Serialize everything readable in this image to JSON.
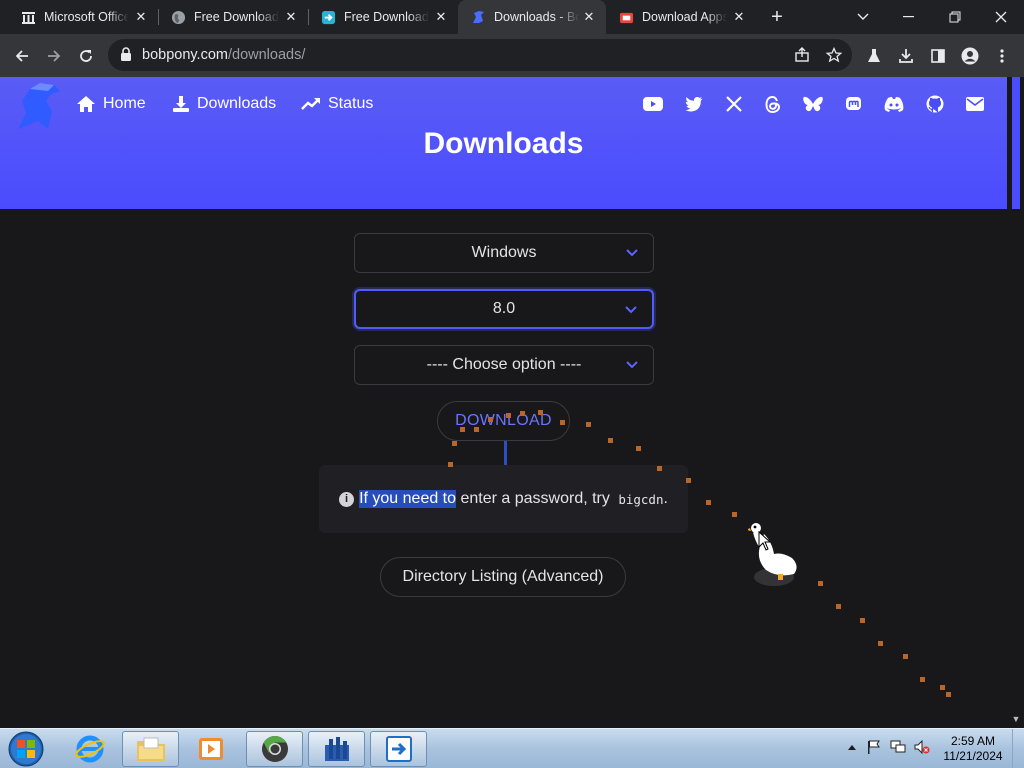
{
  "browser": {
    "tabs": [
      {
        "title": "Microsoft Office",
        "icon": "columns-icon"
      },
      {
        "title": "Free Download",
        "icon": "globe-icon"
      },
      {
        "title": "Free Download",
        "icon": "arrow-app-icon"
      },
      {
        "title": "Downloads - BobPony",
        "icon": "bobpony-icon",
        "active": true
      },
      {
        "title": "Download Apps",
        "icon": "store-icon"
      }
    ],
    "url_host": "bobpony.com",
    "url_path": "/downloads/"
  },
  "site": {
    "nav": {
      "home": "Home",
      "downloads": "Downloads",
      "status": "Status"
    },
    "social_icons": [
      "youtube-icon",
      "twitter-icon",
      "x-icon",
      "threads-icon",
      "bluesky-icon",
      "mastodon-icon",
      "discord-icon",
      "github-icon",
      "mail-icon"
    ],
    "page_title": "Downloads",
    "os_select": "Windows",
    "version_select": "8.0",
    "option_select": "---- Choose option ----",
    "download_button": "DOWNLOAD",
    "note_highlight": "If you need to",
    "note_text": " enter a password, try ",
    "note_code": "bigcdn",
    "note_end": ".",
    "directory_button": "Directory Listing (Advanced)",
    "accent": "#4a4cff"
  },
  "taskbar": {
    "time": "2:59 AM",
    "date": "11/21/2024"
  }
}
